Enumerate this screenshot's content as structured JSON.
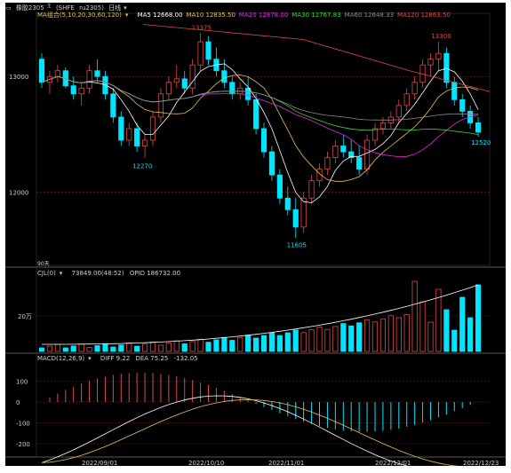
{
  "header": {
    "icon": "rect-icon",
    "symbol": "橡胶2305",
    "superscript": "主",
    "exchange": "(SHFE",
    "code": "ru2305)",
    "period": "日线",
    "period_arrow": "▾"
  },
  "ma_legend": {
    "label": "MA组合(5,10,20,30,60,120)",
    "arrow": "▾",
    "items": [
      {
        "name": "MA5",
        "value": "12668.00",
        "color": "#ffffff"
      },
      {
        "name": "MA10",
        "value": "12835.50",
        "color": "#e3c15c"
      },
      {
        "name": "MA20",
        "value": "12878.00",
        "color": "#e02be0"
      },
      {
        "name": "MA30",
        "value": "12767.83",
        "color": "#3cd23c"
      },
      {
        "name": "MA60",
        "value": "12648.33",
        "color": "#8c8c8c"
      },
      {
        "name": "MA120",
        "value": "12863.50",
        "color": "#e04848"
      }
    ]
  },
  "price_axis": {
    "labels": [
      "13000",
      "12000"
    ]
  },
  "annotations": {
    "high1": "13375",
    "low1": "12270",
    "low2": "11605",
    "high2": "13300",
    "last": "12520"
  },
  "volume_panel": {
    "label": "CJL(0)",
    "arrow": "▾",
    "vol": "73849.00(48:52)",
    "opid": "OPID 186732.00",
    "axis_label": "20万",
    "top_label": "90天"
  },
  "macd_panel": {
    "label": "MACD(12,26,9)",
    "arrow": "▾",
    "diff": "DIFF 9.22",
    "dea": "DEA 75.25",
    "macd": "-132.05",
    "axis": [
      "100",
      "0",
      "-100",
      "-200"
    ]
  },
  "x_axis": {
    "labels": [
      "2022/09/01",
      "2022/10/10",
      "2022/11/01",
      "2022/12/01",
      "2022/12/23"
    ]
  },
  "colors": {
    "up": "#e04848",
    "down": "#00e5ff",
    "bg": "#000000",
    "grid": "#8b1a1a"
  },
  "chart_data": {
    "type": "candlestick",
    "series": [
      {
        "name": "price",
        "values": [
          [
            13150,
            13200,
            12900,
            12950
          ],
          [
            12950,
            13050,
            12850,
            13000
          ],
          [
            13000,
            13100,
            12950,
            13050
          ],
          [
            13050,
            13080,
            12900,
            12920
          ],
          [
            12920,
            13000,
            12800,
            12850
          ],
          [
            12850,
            12950,
            12750,
            12900
          ],
          [
            12900,
            13100,
            12850,
            13050
          ],
          [
            13050,
            13150,
            12950,
            13000
          ],
          [
            13000,
            13050,
            12800,
            12850
          ],
          [
            12850,
            12900,
            12600,
            12650
          ],
          [
            12650,
            12700,
            12400,
            12450
          ],
          [
            12450,
            12600,
            12400,
            12550
          ],
          [
            12550,
            12600,
            12350,
            12400
          ],
          [
            12400,
            12500,
            12300,
            12450
          ],
          [
            12450,
            12700,
            12400,
            12650
          ],
          [
            12650,
            12900,
            12600,
            12850
          ],
          [
            12850,
            13000,
            12800,
            12950
          ],
          [
            12950,
            13100,
            12900,
            12980
          ],
          [
            12980,
            13050,
            12850,
            12900
          ],
          [
            12900,
            13150,
            12850,
            13100
          ],
          [
            13100,
            13375,
            13050,
            13300
          ],
          [
            13300,
            13350,
            13100,
            13150
          ],
          [
            13150,
            13250,
            13000,
            13050
          ],
          [
            13050,
            13150,
            12900,
            12950
          ],
          [
            12950,
            13000,
            12800,
            12850
          ],
          [
            12850,
            12950,
            12800,
            12900
          ],
          [
            12900,
            13000,
            12750,
            12800
          ],
          [
            12800,
            12850,
            12500,
            12550
          ],
          [
            12550,
            12600,
            12300,
            12350
          ],
          [
            12350,
            12400,
            12100,
            12150
          ],
          [
            12150,
            12200,
            11900,
            11950
          ],
          [
            11950,
            12050,
            11800,
            11850
          ],
          [
            11850,
            11950,
            11605,
            11700
          ],
          [
            11700,
            12000,
            11650,
            11950
          ],
          [
            11950,
            12150,
            11900,
            12100
          ],
          [
            12100,
            12250,
            12050,
            12200
          ],
          [
            12200,
            12350,
            12150,
            12300
          ],
          [
            12300,
            12450,
            12250,
            12400
          ],
          [
            12400,
            12500,
            12300,
            12350
          ],
          [
            12350,
            12450,
            12250,
            12300
          ],
          [
            12300,
            12400,
            12150,
            12200
          ],
          [
            12200,
            12500,
            12150,
            12450
          ],
          [
            12450,
            12600,
            12400,
            12550
          ],
          [
            12550,
            12650,
            12500,
            12600
          ],
          [
            12600,
            12700,
            12550,
            12650
          ],
          [
            12650,
            12800,
            12600,
            12750
          ],
          [
            12750,
            12900,
            12700,
            12850
          ],
          [
            12850,
            13000,
            12800,
            12950
          ],
          [
            12950,
            13150,
            12900,
            13100
          ],
          [
            13100,
            13200,
            13000,
            13150
          ],
          [
            13150,
            13300,
            13050,
            13200
          ],
          [
            13200,
            13250,
            12900,
            12950
          ],
          [
            12950,
            13000,
            12750,
            12800
          ],
          [
            12800,
            12850,
            12650,
            12700
          ],
          [
            12700,
            12750,
            12550,
            12600
          ],
          [
            12600,
            12650,
            12480,
            12520
          ]
        ]
      }
    ],
    "xlabels": [
      "2022/09/01",
      "2022/10/10",
      "2022/11/01",
      "2022/12/01",
      "2022/12/23"
    ]
  }
}
